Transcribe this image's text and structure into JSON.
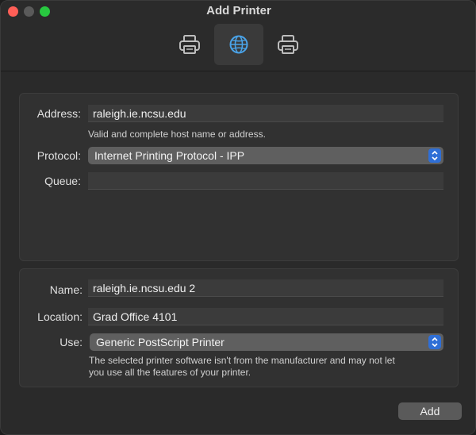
{
  "window": {
    "title": "Add Printer"
  },
  "toolbar": {
    "items": [
      {
        "name": "default",
        "icon": "printer-icon",
        "selected": false
      },
      {
        "name": "ip",
        "icon": "globe-icon",
        "selected": true
      },
      {
        "name": "windows",
        "icon": "printer-icon",
        "selected": false
      }
    ]
  },
  "form_top": {
    "address_label": "Address:",
    "address_value": "raleigh.ie.ncsu.edu",
    "address_hint": "Valid and complete host name or address.",
    "protocol_label": "Protocol:",
    "protocol_value": "Internet Printing Protocol - IPP",
    "queue_label": "Queue:",
    "queue_value": ""
  },
  "form_bottom": {
    "name_label": "Name:",
    "name_value": "raleigh.ie.ncsu.edu 2",
    "location_label": "Location:",
    "location_value": "Grad Office 4101",
    "use_label": "Use:",
    "use_value": "Generic PostScript Printer",
    "use_hint_line1": "The selected printer software isn't from the manufacturer and may not let",
    "use_hint_line2": "you use all the features of your printer."
  },
  "footer": {
    "add_label": "Add"
  },
  "colors": {
    "accent": "#2f6fd6",
    "globe": "#4aa3e8"
  }
}
